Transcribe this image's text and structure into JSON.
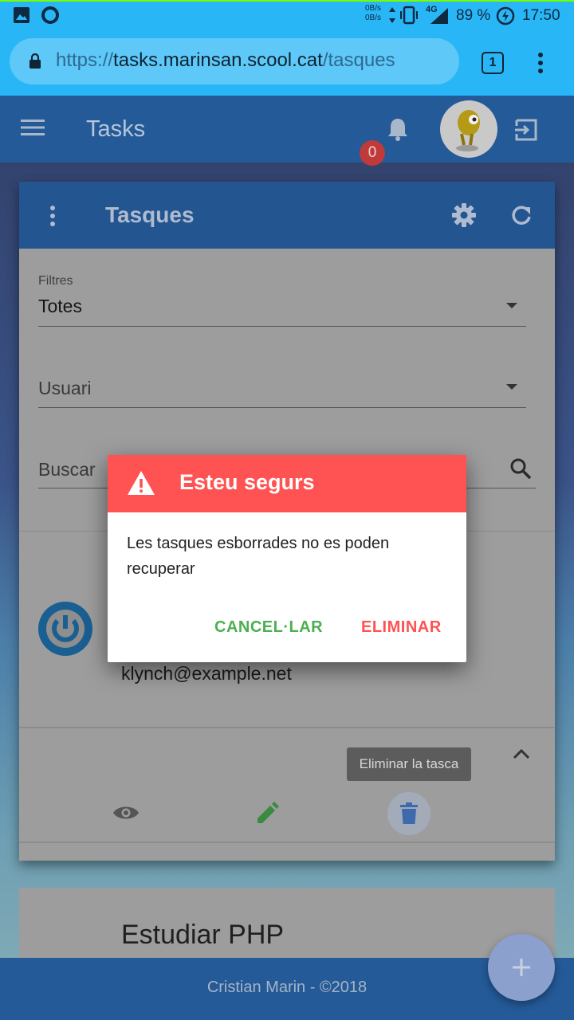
{
  "status_bar": {
    "net_up": "0B/s",
    "net_down": "0B/s",
    "network": "4G",
    "battery": "89 %",
    "time": "17:50"
  },
  "browser": {
    "url_protocol": "https://",
    "url_host": "tasks.marinsan.scool.cat",
    "url_path": "/tasques",
    "tab_count": "1"
  },
  "app_bar": {
    "title": "Tasks",
    "notification_count": "0"
  },
  "card": {
    "title": "Tasques",
    "filter": {
      "label": "Filtres",
      "value": "Totes"
    },
    "user_select": {
      "placeholder": "Usuari"
    },
    "search": {
      "placeholder": "Buscar"
    },
    "task_email": "klynch@example.net",
    "tooltip": "Eliminar la tasca"
  },
  "next_task": {
    "name": "Estudiar PHP"
  },
  "footer": {
    "text": "Cristian Marin - ©2018"
  },
  "dialog": {
    "title": "Esteu segurs",
    "message": "Les tasques esborrades no es poden recuperar",
    "cancel_label": "CANCEL·LAR",
    "confirm_label": "ELIMINAR"
  },
  "colors": {
    "app_bar": "#245a98",
    "dialog_header": "#ff5252",
    "cancel": "#4caf50",
    "confirm": "#ff5252",
    "edit_icon": "#3a8a3f"
  }
}
